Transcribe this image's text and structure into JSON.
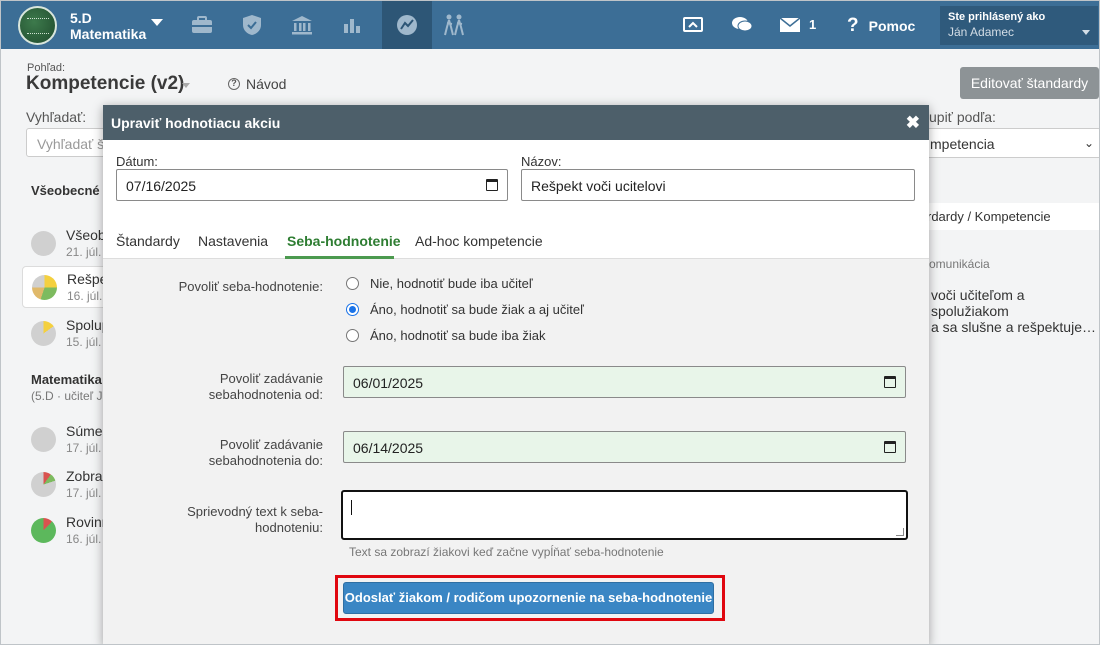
{
  "topbar": {
    "class_name": "5.D",
    "subject": "Matematika",
    "mail_count": "1",
    "help_label": "Pomoc",
    "user_label": "Ste prihlásený ako",
    "user_name": "Ján Adamec",
    "nav_icons": [
      "briefcase-icon",
      "shield-check-icon",
      "bank-icon",
      "bar-chart-icon",
      "chart-circle-icon",
      "people-walking-icon"
    ],
    "right_icons": [
      "cast-icon",
      "chat-icon",
      "envelope-icon",
      "question-icon"
    ],
    "colors": {
      "bar": "#3c6e96",
      "active": "#2d5676"
    }
  },
  "page": {
    "view_label": "Pohľad:",
    "view_title": "Kompetencie (v2)",
    "guide_label": "Návod",
    "edit_button": "Editovať štandardy",
    "search_label": "Vyhľadať:",
    "search_placeholder": "Vyhľadať š",
    "group_label": "upiť podľa:",
    "group_value": "mpetencia"
  },
  "left": {
    "section1_title": "Všeobecné",
    "items1": [
      {
        "title": "Všeob",
        "date": "21. júl.",
        "pie": "gray"
      },
      {
        "title": "Rešpe",
        "date": "16. júl.",
        "pie": "mixed"
      },
      {
        "title": "Spolup",
        "date": "15. júl.",
        "pie": "yellow"
      }
    ],
    "section2_title": "Matematika",
    "section2_sub": "(5.D · učiteľ J",
    "items2": [
      {
        "title": "Súmer",
        "date": "17. júl.",
        "pie": "gray"
      },
      {
        "title": "Zobraz",
        "date": "17. júl.",
        "pie": "red-green"
      },
      {
        "title": "Rovinn",
        "date": "16. júl.",
        "pie": "green"
      }
    ]
  },
  "right": {
    "tab_label": "rdardy / Kompetencie",
    "category": "omunikácia",
    "description": "voči učiteľom a spolužiakom\na sa slušne a rešpektuje…"
  },
  "modal": {
    "title": "Upraviť hodnotiacu akciu",
    "date_label": "Dátum:",
    "date_value": "07/16/2025",
    "name_label": "Názov:",
    "name_value": "Rešpekt voči ucitelovi",
    "tabs": [
      "Štandardy",
      "Nastavenia",
      "Seba-hodnotenie",
      "Ad-hoc kompetencie"
    ],
    "active_tab": "Seba-hodnotenie",
    "allow_label": "Povoliť seba-hodnotenie:",
    "radio_options": [
      "Nie, hodnotiť bude iba učiteľ",
      "Áno, hodnotiť sa bude žiak a aj učiteľ",
      "Áno, hodnotiť sa bude iba žiak"
    ],
    "selected_option": 1,
    "from_label_1": "Povoliť zadávanie",
    "from_label_2": "sebahodnotenia od:",
    "from_value": "06/01/2025",
    "to_label_1": "Povoliť zadávanie",
    "to_label_2": "sebahodnotenia do:",
    "to_value": "06/14/2025",
    "text_label_1": "Sprievodný text k seba-",
    "text_label_2": "hodnoteniu:",
    "text_hint": "Text sa zobrazí žiakovi keď začne vypĺňať seba-hodnotenie",
    "notify_button": "Odoslať žiakom / rodičom upozornenie na seba-hodnotenie"
  }
}
